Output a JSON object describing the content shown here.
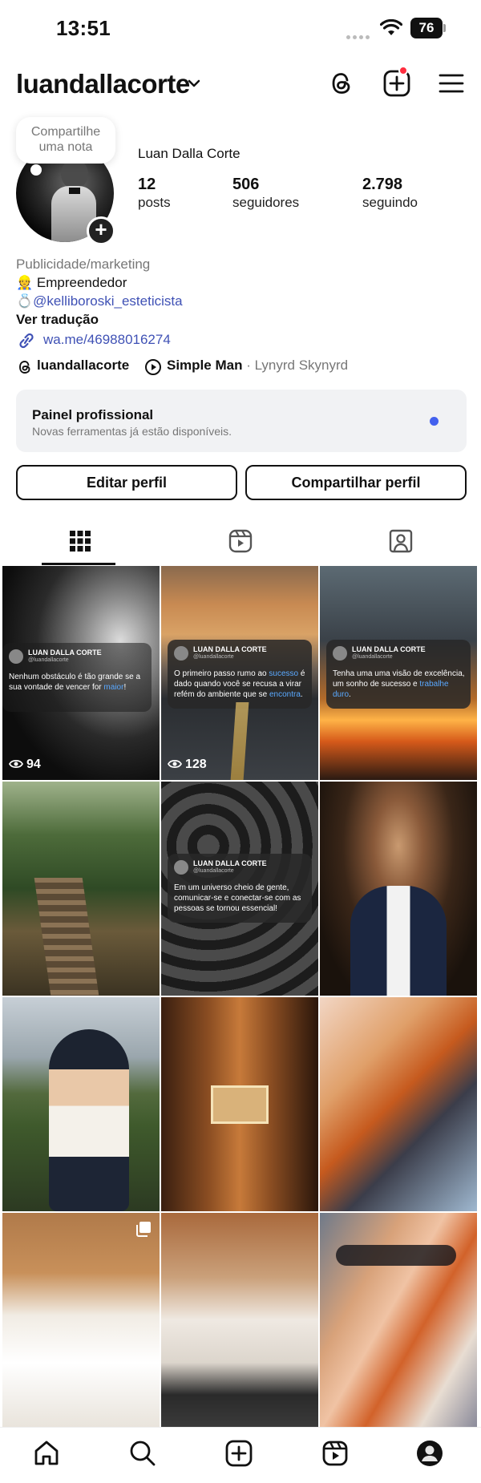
{
  "status_bar": {
    "time": "13:51",
    "battery": "76"
  },
  "header": {
    "username": "luandallacorte"
  },
  "note": {
    "line1": "Compartilhe",
    "line2": "uma nota"
  },
  "profile": {
    "display_name": "Luan Dalla Corte",
    "stats": [
      {
        "value": "12",
        "label": "posts"
      },
      {
        "value": "506",
        "label": "seguidores"
      },
      {
        "value": "2.798",
        "label": "seguindo"
      }
    ]
  },
  "bio": {
    "category": "Publicidade/marketing",
    "line1": "👷 Empreendedor",
    "mention": "@kelliboroski_esteticista",
    "mention_prefix": "💍",
    "translate": "Ver tradução",
    "link": "wa.me/46988016274"
  },
  "chips": {
    "threads_handle": "luandallacorte",
    "song": "Simple Man",
    "artist": " · Lynyrd Skynyrd"
  },
  "pro_panel": {
    "title": "Painel profissional",
    "subtitle": "Novas ferramentas já estão disponíveis."
  },
  "buttons": {
    "edit": "Editar perfil",
    "share": "Compartilhar perfil"
  },
  "grid": {
    "quote_name": "LUAN DALLA CORTE",
    "quote_handle": "@luandallacorte",
    "posts": [
      {
        "views": "94",
        "quote_pre": "Nenhum obstáculo é tão grande se a sua vontade de vencer for ",
        "quote_hl": "maior",
        "quote_post": "!"
      },
      {
        "views": "128",
        "quote_pre": "O primeiro passo rumo ao ",
        "quote_hl": "sucesso",
        "quote_mid": " é dado quando você se recusa a virar refém do ambiente que se ",
        "quote_hl2": "encontra",
        "quote_post": "."
      },
      {
        "quote_pre": "Tenha uma uma visão de excelência, um sonho de sucesso e ",
        "quote_hl": "trabalhe duro",
        "quote_post": "."
      },
      {},
      {
        "quote_pre": "Em um universo cheio de gente, comunicar-se e conectar-se com as pessoas se tornou essencial!"
      }
    ]
  }
}
